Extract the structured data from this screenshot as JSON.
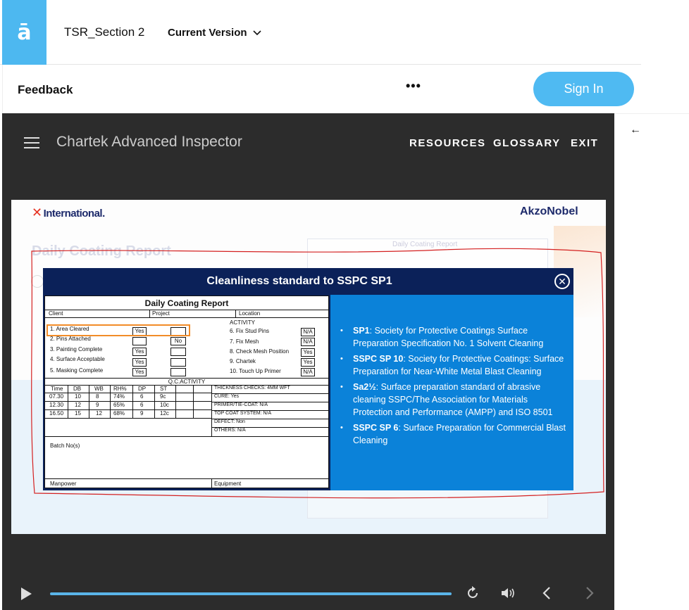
{
  "topbar": {
    "logo_glyph": "ā",
    "course_title": "TSR_Section 2",
    "version_label": "Current Version"
  },
  "subbar": {
    "feedback_label": "Feedback",
    "more_label": "•••",
    "signin_label": "Sign In"
  },
  "player": {
    "app_title": "Chartek Advanced Inspector",
    "nav": [
      "RESOURCES",
      "GLOSSARY",
      "EXIT"
    ]
  },
  "slide": {
    "brand_left": "International.",
    "brand_right": "AkzoNobel",
    "bg_title": "Daily Coating Report",
    "bg_form_title": "Daily Coating Report"
  },
  "modal": {
    "title": "Cleanliness standard to SSPC SP1",
    "close_glyph": "✕",
    "definitions": [
      {
        "term": "SP1",
        "text": ": Society for Protective Coatings Surface Preparation Specification No. 1 Solvent Cleaning"
      },
      {
        "term": "SSPC SP 10",
        "text": ": Society for Protective Coatings: Surface Preparation for Near-White Metal Blast Cleaning"
      },
      {
        "term": "Sa2½",
        "text": ": Surface preparation standard of abrasive cleaning SSPC/The Association for Materials Protection and Performance (AMPP) and ISO 8501"
      },
      {
        "term": "SSPC SP 6",
        "text": ": Surface Preparation for Commercial Blast Cleaning"
      }
    ]
  },
  "form": {
    "title": "Daily Coating Report",
    "header_client": "Client",
    "header_project": "Project",
    "header_location": "Location",
    "activity_label": "ACTIVITY",
    "left_items": [
      "1. Area Cleared",
      "2. Pins Attached",
      "3. Painting Complete",
      "4. Surface Acceptable",
      "5. Masking Complete"
    ],
    "left_values": [
      "Yes",
      "",
      "Yes",
      "Yes",
      "Yes"
    ],
    "no_value": "No",
    "right_items": [
      "6. Fix Stud Pins",
      "7. Fix Mesh",
      "8. Check Mesh Position",
      "9. Chartek",
      "10. Touch Up Primer"
    ],
    "right_values": [
      "N/A",
      "N/A",
      "Yes",
      "Yes",
      "N/A"
    ],
    "qc_label": "Q.C.ACTIVITY",
    "qc_headers": [
      "Time",
      "DB",
      "WB",
      "RH%",
      "DP",
      "ST"
    ],
    "qc_rows": [
      [
        "07.30",
        "10",
        "8",
        "74%",
        "6",
        "9c"
      ],
      [
        "12.30",
        "12",
        "9",
        "65%",
        "6",
        "10c"
      ],
      [
        "16.50",
        "15",
        "12",
        "68%",
        "9",
        "12c"
      ]
    ],
    "checks": [
      "THICKNESS CHECKS:  4MM WFT",
      "CURE: Yes",
      "PRIMER/TIE-COAT: N/A",
      "TOP COAT SYSTEM: N/A",
      "DEFECT: Non",
      "OTHERS: N/A"
    ],
    "batch_label": "Batch No(s)",
    "manpower_label": "Manpower",
    "equipment_label": "Equipment"
  },
  "colors": {
    "accent": "#4fbaf2",
    "modal_header": "#0b2159",
    "modal_panel": "#0b82d9",
    "player_bg": "#2c2c2c",
    "highlight": "#f28c28",
    "annotation": "#d42020"
  },
  "icons": {
    "menu": "hamburger-icon",
    "close": "close-circle-icon",
    "play": "play-icon",
    "replay": "replay-icon",
    "volume": "volume-icon",
    "prev": "chevron-left-icon",
    "next": "chevron-right-icon",
    "back": "arrow-left-icon"
  }
}
